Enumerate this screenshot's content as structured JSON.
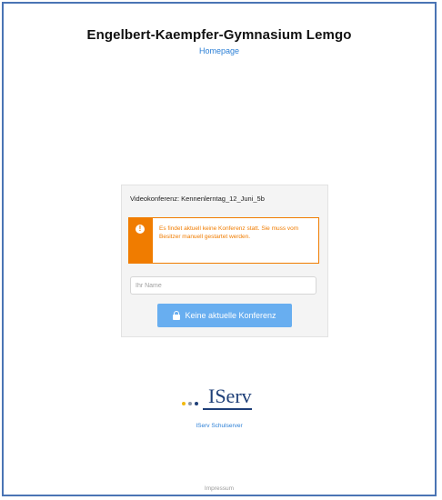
{
  "header": {
    "site_title": "Engelbert-Kaempfer-Gymnasium Lemgo",
    "homepage_link": "Homepage"
  },
  "conference": {
    "label": "Videokonferenz: Kennenlerntag_12_Juni_5b",
    "alert_icon": "exclamation-circle-icon",
    "alert_text": "Es findet aktuell keine Konferenz statt. Sie muss vom Besitzer manuell gestartet werden.",
    "name_placeholder": "Ihr Name",
    "name_value": "",
    "button_icon": "lock-icon",
    "button_label": "Keine aktuelle Konferenz"
  },
  "logo": {
    "text": "IServ",
    "dot_colors": [
      "#f2b90f",
      "#8a95a8",
      "#1e3f78"
    ]
  },
  "footer": {
    "server_link": "IServ Schulserver",
    "imprint_link": "Impressum"
  },
  "colors": {
    "accent": "#f07c00",
    "button": "#68aef0",
    "link": "#2b7fd6",
    "frame": "#4a74b4"
  }
}
